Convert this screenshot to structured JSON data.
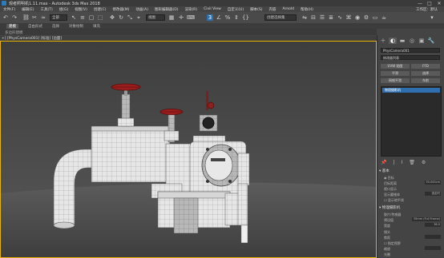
{
  "window": {
    "title": "观者照明机1.11.max - Autodesk 3ds Max 2018",
    "controls": [
      "—",
      "□",
      "✕"
    ]
  },
  "menu": {
    "items": [
      "文件(F)",
      "编辑(E)",
      "工具(T)",
      "组(G)",
      "视图(V)",
      "创建(C)",
      "修改器(M)",
      "动画(A)",
      "图形编辑器(D)",
      "渲染(R)",
      "Civil View",
      "自定义(U)",
      "脚本(S)",
      "内容",
      "Arnold",
      "帮助(H)"
    ],
    "workspace": "工作区：默认"
  },
  "toolbar": {
    "filter_dropdown": "全部",
    "view_dropdown": "视图",
    "selection_set": "创建选择集"
  },
  "ribbon": {
    "tabs": [
      "建模",
      "自由形式",
      "选择",
      "对象绘制",
      "填充"
    ],
    "active_tab": "建模",
    "subtitle": "多边形建模"
  },
  "viewport": {
    "label": "+] [PhysCamera001] [标准] [边面]"
  },
  "command_panel": {
    "tabs": [
      "＋",
      "◐",
      "▬",
      "◎",
      "▣",
      "🔧"
    ],
    "object_name": "PhysCamera001",
    "modifier_list": "修改器列表",
    "buttons": [
      "UVW 贴图",
      "FFD",
      "平滑",
      "选择",
      "网格平滑",
      "车削"
    ],
    "stack_item": "物理摄影机",
    "stack_icons": [
      "📌",
      "|",
      "Ⅰ",
      "🗑",
      "⚙"
    ],
    "basic_rollout": "基本",
    "target_label": "目标",
    "target_distance_label": "目标距离",
    "target_distance_value": "30.000cm",
    "viewport_display_label": "视口显示",
    "show_cone_label": "显示圆锥体",
    "cone_value": "选定时",
    "show_horizon_label": "显示地平线",
    "physical_rollout": "物理摄影机",
    "film_sensor_label": "胶片/传感器",
    "preset_label": "预设值",
    "preset_value": "35mm (Full Frame)",
    "width_label": "宽度",
    "width_value": "36.0",
    "lens_label": "镜头",
    "focal_label": "焦距",
    "specify_fov_label": "指定视野",
    "zoom_label": "缩放",
    "aperture_label": "光圈",
    "focus_label": "聚焦",
    "use_target_label": "使用目标距离",
    "custom_label": "自定义"
  }
}
